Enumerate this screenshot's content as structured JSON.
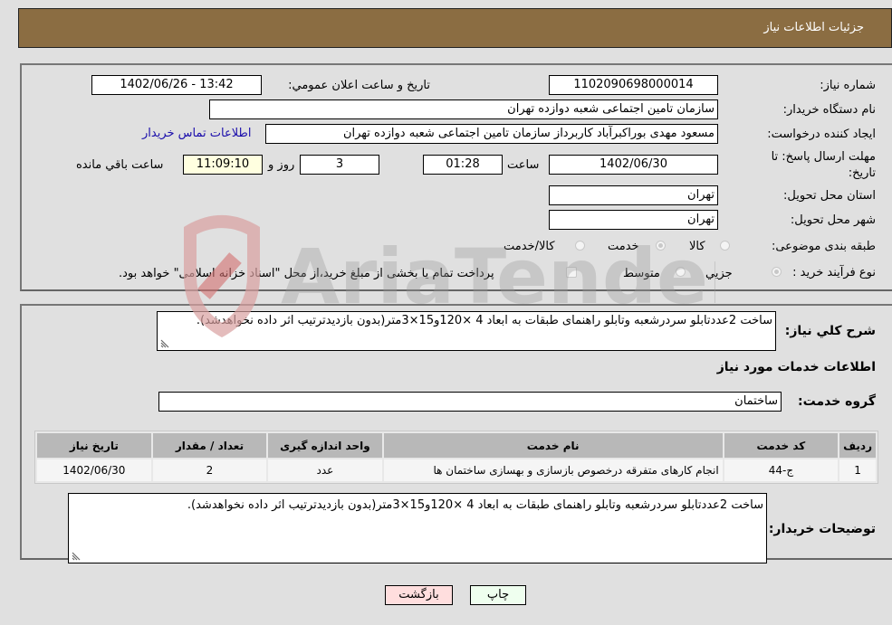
{
  "header": {
    "title": "جزئیات اطلاعات نیاز"
  },
  "fields": {
    "need_number": {
      "label": "شماره نیاز:",
      "value": "1102090698000014"
    },
    "announce_datetime": {
      "label": "تاریخ و ساعت اعلان عمومي:",
      "value": "1402/06/26 - 13:42"
    },
    "buyer_org": {
      "label": "نام دستگاه خریدار:",
      "value": "سازمان تامین اجتماعی شعبه دوازده تهران"
    },
    "requester": {
      "label": "ایجاد کننده درخواست:",
      "value": "مسعود مهدی بوراکبرآباد کاربرداز سازمان تامین اجتماعی شعبه دوازده تهران"
    },
    "buyer_contact_link": "اطلاعات تماس خریدار",
    "deadline": {
      "label": "مهلت ارسال پاسخ: تا تاریخ:",
      "date": "1402/06/30",
      "time_label": "ساعت",
      "time": "01:28",
      "days": "3",
      "days_label": "روز و",
      "remaining": "11:09:10",
      "remaining_label": "ساعت باقي مانده"
    },
    "province": {
      "label": "استان محل تحویل:",
      "value": "تهران"
    },
    "city": {
      "label": "شهر محل تحویل:",
      "value": "تهران"
    },
    "category": {
      "label": "طبقه بندی موضوعی:",
      "options": [
        "کالا",
        "خدمت",
        "کالا/خدمت"
      ],
      "selected": "خدمت"
    },
    "purchase_type": {
      "label": "نوع فرآیند خرید :",
      "options": [
        "جزیي",
        "متوسط"
      ],
      "selected": "جزیي",
      "treasury_note": "پرداخت تمام یا بخشی از مبلغ خرید،از محل \"اسناد خزانه اسلامی\" خواهد بود."
    }
  },
  "description": {
    "label": "شرح کلي نیاز:",
    "value": "ساخت 2عددتابلو سردرشعبه وتابلو راهنمای طبقات به ابعاد 4 ×120و15×3متر(بدون بازدیدترتیب اثر داده نخواهدشد)."
  },
  "services_section": {
    "title": "اطلاعات خدمات مورد نیاز",
    "group_label": "گروه خدمت:",
    "group_value": "ساختمان"
  },
  "items_table": {
    "columns": [
      "ردیف",
      "کد خدمت",
      "نام خدمت",
      "واحد اندازه گیری",
      "تعداد / مقدار",
      "تاریخ نیاز"
    ],
    "rows": [
      [
        "1",
        "ج-44",
        "انجام کارهای متفرقه درخصوص بازسازی و بهسازی ساختمان ها",
        "عدد",
        "2",
        "1402/06/30"
      ]
    ]
  },
  "buyer_notes": {
    "label": "توضیحات خریدار:",
    "value": "ساخت 2عددتابلو سردرشعبه وتابلو راهنمای طبقات به ابعاد 4 ×120و15×3متر(بدون بازدیدترتیب اثر داده نخواهدشد)."
  },
  "buttons": {
    "print": "چاپ",
    "back": "بازگشت"
  },
  "colors": {
    "header": "#8b6d42",
    "print_bg": "#efffef",
    "back_bg": "#ffdede",
    "link": "#1a0dab",
    "remaining_bg": "#ffffe0"
  },
  "watermark": "AriaTender.neT"
}
